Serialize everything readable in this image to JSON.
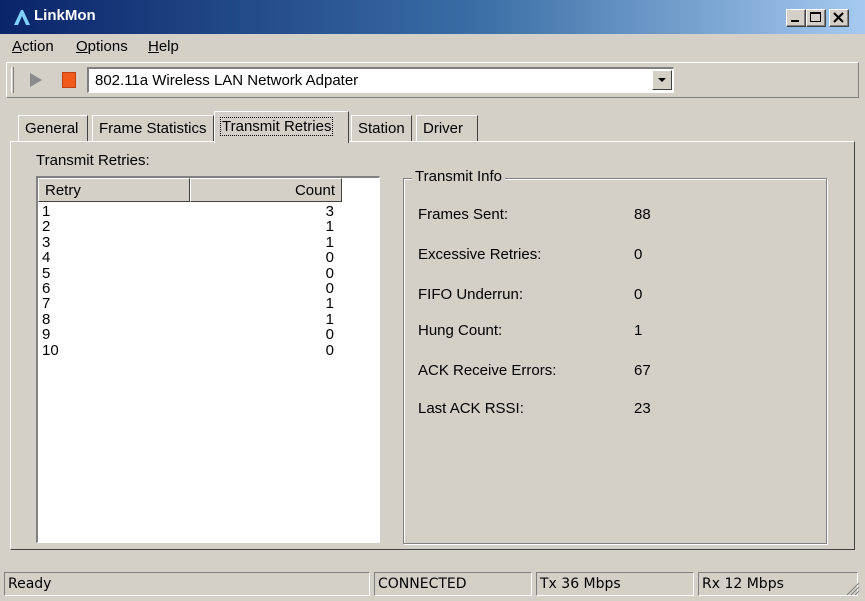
{
  "window": {
    "title": "LinkMon"
  },
  "menu": [
    {
      "label": "Action",
      "accel": "A",
      "rest": "ction"
    },
    {
      "label": "Options",
      "accel": "O",
      "rest": "ptions"
    },
    {
      "label": "Help",
      "accel": "H",
      "rest": "elp"
    }
  ],
  "toolbar": {
    "adapter": "802.11a Wireless LAN Network Adpater",
    "colors": {
      "stop": "#f05a1a",
      "play": "#808080"
    }
  },
  "tabs": [
    {
      "label": "General"
    },
    {
      "label": "Frame Statistics"
    },
    {
      "label": "Transmit Retries"
    },
    {
      "label": "Station"
    },
    {
      "label": "Driver"
    }
  ],
  "retries": {
    "label": "Transmit Retries:",
    "columns": {
      "retry": "Retry",
      "count": "Count"
    },
    "rows": [
      {
        "retry": "1",
        "count": "3"
      },
      {
        "retry": "2",
        "count": "1"
      },
      {
        "retry": "3",
        "count": "1"
      },
      {
        "retry": "4",
        "count": "0"
      },
      {
        "retry": "5",
        "count": "0"
      },
      {
        "retry": "6",
        "count": "0"
      },
      {
        "retry": "7",
        "count": "1"
      },
      {
        "retry": "8",
        "count": "1"
      },
      {
        "retry": "9",
        "count": "0"
      },
      {
        "retry": "10",
        "count": "0"
      }
    ]
  },
  "transmit_info": {
    "title": "Transmit Info",
    "items": [
      {
        "label": "Frames Sent:",
        "value": "88"
      },
      {
        "label": "Excessive Retries:",
        "value": "0"
      },
      {
        "label": "FIFO Underrun:",
        "value": "0"
      },
      {
        "label": "Hung Count:",
        "value": "1"
      },
      {
        "label": "ACK Receive Errors:",
        "value": "67"
      },
      {
        "label": "Last ACK RSSI:",
        "value": "23"
      }
    ]
  },
  "status": {
    "message": "Ready",
    "connection": "CONNECTED",
    "tx": "Tx 36 Mbps",
    "rx": "Rx 12 Mbps"
  }
}
